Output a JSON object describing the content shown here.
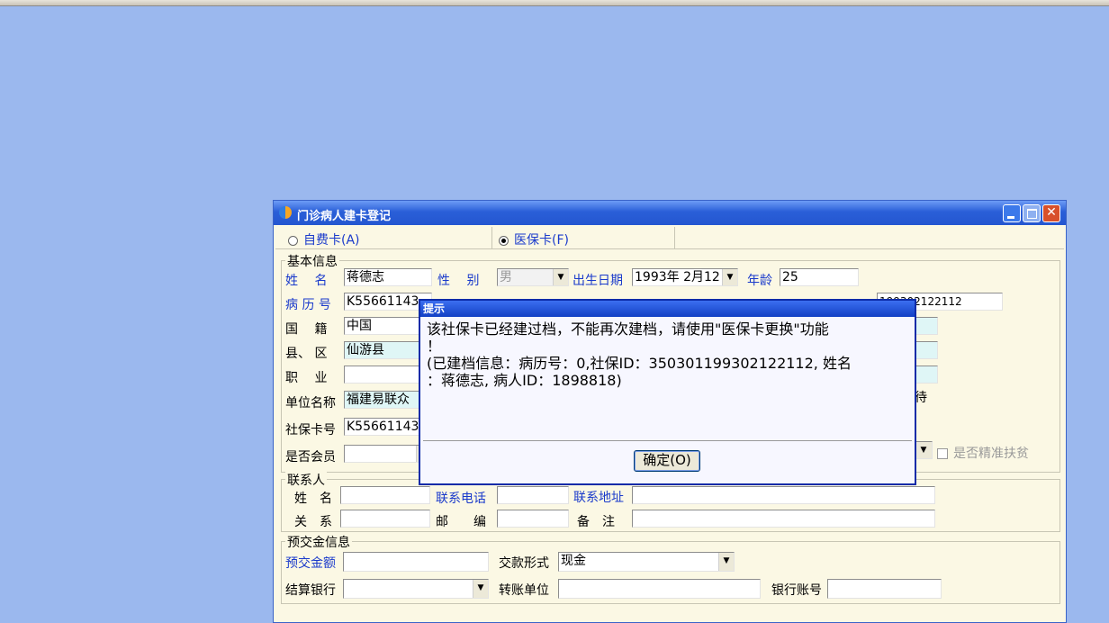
{
  "window": {
    "title": "门诊病人建卡登记",
    "card_type": {
      "self_pay": "自费卡(A)",
      "insurance": "医保卡(F)",
      "selected": "insurance"
    }
  },
  "basic": {
    "section": "基本信息",
    "name_label": "姓　 名",
    "name": "蒋德志",
    "gender_label": "性　 别",
    "gender": "男",
    "dob_label": "出生日期",
    "dob": "1993年 2月12",
    "age_label": "年龄",
    "age": "25",
    "record_label": "病 历 号",
    "record": "K55661143",
    "partial_id": "199302122112",
    "nation_label": "国　 籍",
    "nation": "中国",
    "county_label": "县、 区",
    "county": "仙游县",
    "job_label": "职　 业",
    "job": "",
    "unit_label": "单位名称",
    "unit": "福建易联众",
    "sicard_label": "社保卡号",
    "sicard": "K55661143",
    "member_label": "是否会员",
    "member": "",
    "right_fragment": "待",
    "poverty_label": "是否精准扶贫"
  },
  "contact": {
    "section": "联系人",
    "name_label": "姓　名",
    "name": "",
    "phone_label": "联系电话",
    "phone": "",
    "addr_label": "联系地址",
    "addr": "",
    "rel_label": "关　系",
    "rel": "",
    "zip_label": "邮　　编",
    "zip": "",
    "note_label": "备　注",
    "note": ""
  },
  "deposit": {
    "section": "预交金信息",
    "amount_label": "预交金额",
    "amount": "",
    "pay_type_label": "交款形式",
    "pay_type": "现金",
    "bank_label": "结算银行",
    "bank": "",
    "transfer_label": "转账单位",
    "transfer": "",
    "account_label": "银行账号",
    "account": ""
  },
  "dialog": {
    "title": "提示",
    "line1": "该社保卡已经建过档，不能再次建档，请使用\"医保卡更换\"功能",
    "line2": "！",
    "line3": "(已建档信息：病历号：0,社保ID：350301199302122112, 姓名",
    "line4": "：蒋德志, 病人ID：1898818)",
    "ok": "确定(O)"
  }
}
